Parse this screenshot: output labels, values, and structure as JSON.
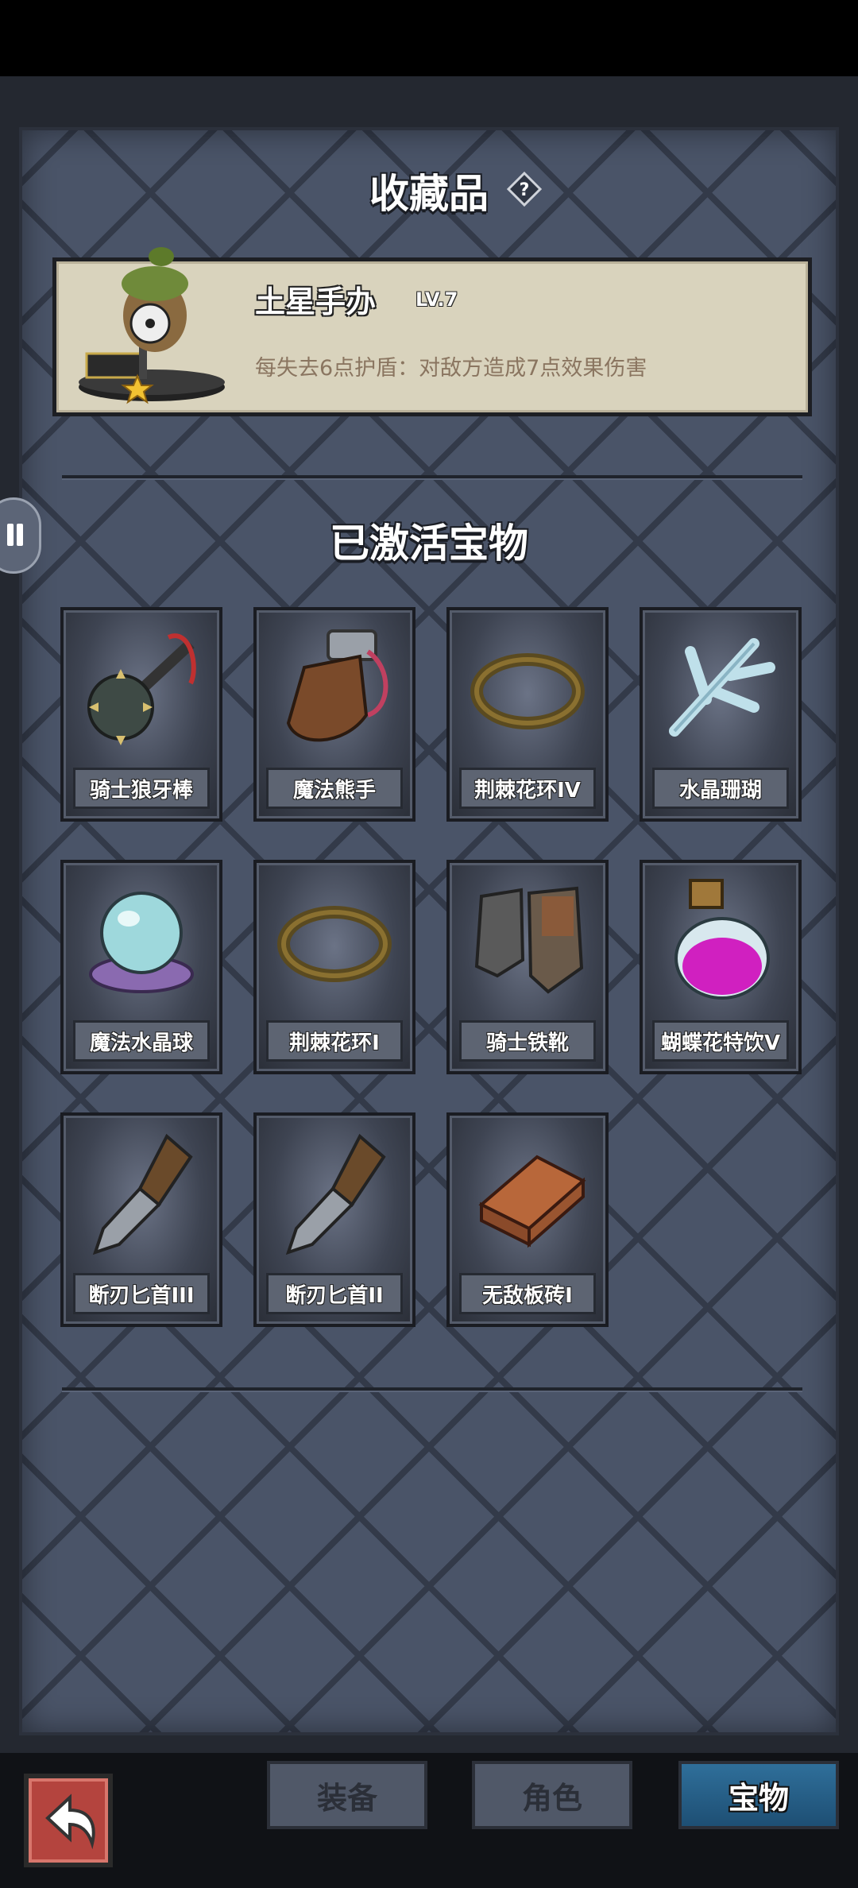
{
  "header": {
    "title": "收藏品"
  },
  "featured": {
    "name": "土星手办",
    "level": "LV.7",
    "description": "每失去6点护盾：对敌方造成7点效果伤害",
    "icon": "saturn-figurine-icon"
  },
  "activated": {
    "title": "已激活宝物",
    "items": [
      {
        "label": "骑士狼牙棒",
        "icon": "spiked-mace-icon"
      },
      {
        "label": "魔法熊手",
        "icon": "bear-paw-icon"
      },
      {
        "label": "荆棘花环IV",
        "icon": "thorn-wreath-icon"
      },
      {
        "label": "水晶珊瑚",
        "icon": "crystal-coral-icon"
      },
      {
        "label": "魔法水晶球",
        "icon": "crystal-ball-icon"
      },
      {
        "label": "荆棘花环I",
        "icon": "thorn-wreath-icon"
      },
      {
        "label": "骑士铁靴",
        "icon": "iron-boots-icon"
      },
      {
        "label": "蝴蝶花特饮V",
        "icon": "potion-bottle-icon"
      },
      {
        "label": "断刃匕首III",
        "icon": "broken-dagger-icon"
      },
      {
        "label": "断刃匕首II",
        "icon": "broken-dagger-icon"
      },
      {
        "label": "无敌板砖I",
        "icon": "brick-icon"
      }
    ]
  },
  "tabs": [
    {
      "label": "装备",
      "active": false
    },
    {
      "label": "角色",
      "active": false
    },
    {
      "label": "宝物",
      "active": true
    }
  ],
  "colors": {
    "accent": "#2f6f9a",
    "back_button": "#b4443e",
    "panel": "#4a5468"
  }
}
